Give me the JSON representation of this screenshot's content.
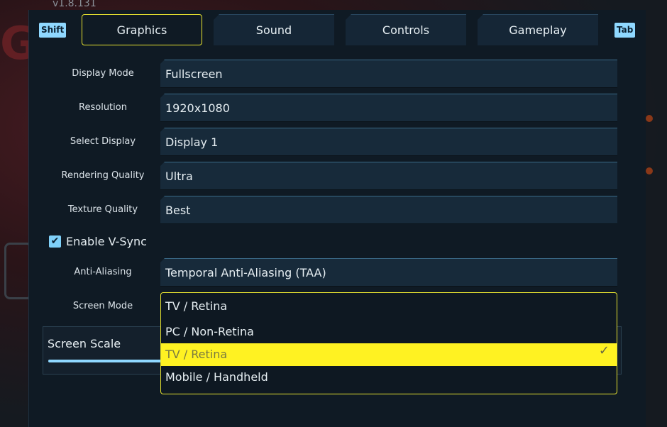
{
  "version": "v1.8.131",
  "background_text": "GH",
  "hotkeys": {
    "prev": "Shift",
    "next": "Tab"
  },
  "tabs": [
    {
      "label": "Graphics",
      "active": true
    },
    {
      "label": "Sound",
      "active": false
    },
    {
      "label": "Controls",
      "active": false
    },
    {
      "label": "Gameplay",
      "active": false
    }
  ],
  "settings": [
    {
      "label": "Display Mode",
      "value": "Fullscreen"
    },
    {
      "label": "Resolution",
      "value": "1920x1080"
    },
    {
      "label": "Select Display",
      "value": "Display 1"
    },
    {
      "label": "Rendering Quality",
      "value": "Ultra"
    },
    {
      "label": "Texture Quality",
      "value": "Best"
    }
  ],
  "vsync": {
    "label": "Enable V-Sync",
    "checked": true,
    "check_glyph": "✔"
  },
  "anti_aliasing": {
    "label": "Anti-Aliasing",
    "value": "Temporal Anti-Aliasing (TAA)"
  },
  "screen_mode": {
    "label": "Screen Mode",
    "current": "TV / Retina",
    "options": [
      {
        "label": "PC / Non-Retina",
        "selected": false
      },
      {
        "label": "TV / Retina",
        "selected": true
      },
      {
        "label": "Mobile / Handheld",
        "selected": false
      }
    ],
    "check_glyph": "✓"
  },
  "screen_scale": {
    "label": "Screen Scale"
  },
  "colors": {
    "accent": "#e8e430",
    "highlight": "#fff222",
    "cyan": "#8fd8ff"
  }
}
